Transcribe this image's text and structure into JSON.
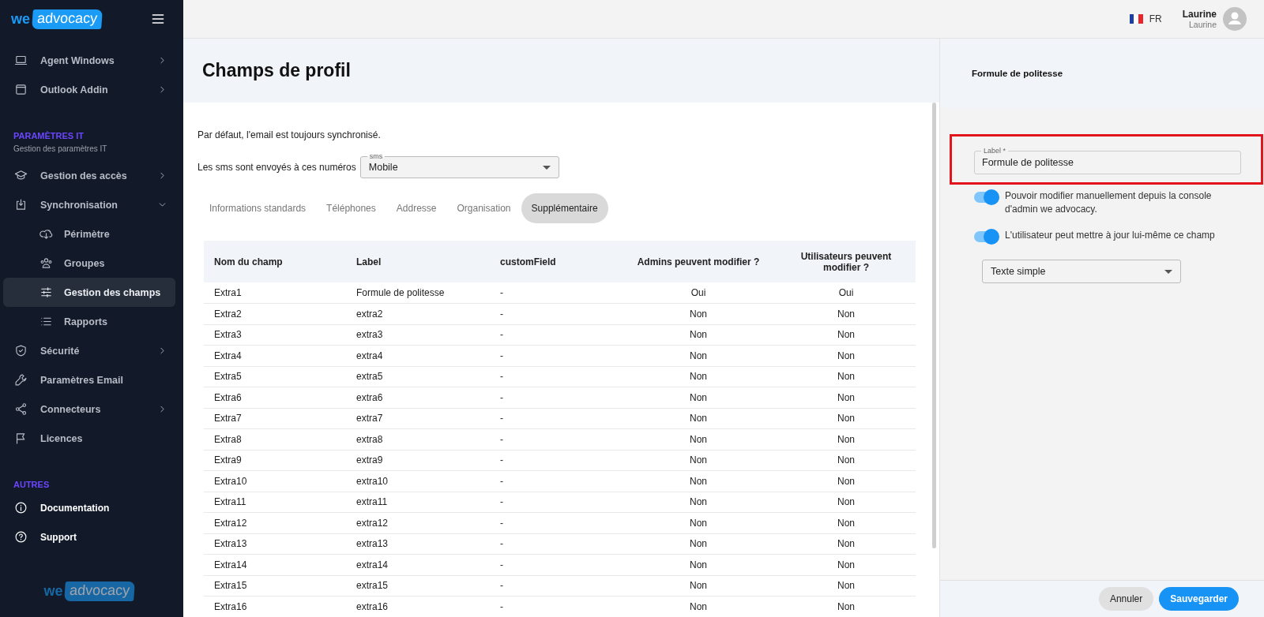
{
  "sidebar": {
    "logo": {
      "part_1": "we",
      "part_2": "advocacy"
    },
    "sections": [
      {
        "items": [
          {
            "label": "Agent Windows",
            "kind": "menu",
            "expanded": false,
            "selected": false
          },
          {
            "label": "Outlook Addin",
            "kind": "menu",
            "expanded": false,
            "selected": false
          }
        ]
      },
      {
        "title": "PARAMÈTRES IT",
        "subtitle": "Gestion des paramètres IT",
        "items": [
          {
            "label": "Gestion des accès",
            "kind": "menu",
            "expanded": false,
            "selected": false
          },
          {
            "label": "Synchronisation",
            "kind": "menu",
            "expanded": true,
            "selected": false,
            "children": [
              {
                "label": "Périmètre",
                "selected": false
              },
              {
                "label": "Groupes",
                "selected": false
              },
              {
                "label": "Gestion des champs",
                "selected": true
              },
              {
                "label": "Rapports",
                "selected": false
              }
            ]
          },
          {
            "label": "Sécurité",
            "kind": "menu",
            "expanded": false,
            "selected": false
          },
          {
            "label": "Paramètres Email",
            "kind": "menu",
            "selected": false
          },
          {
            "label": "Connecteurs",
            "kind": "menu",
            "expanded": false,
            "selected": false
          },
          {
            "label": "Licences",
            "kind": "menu",
            "selected": false
          }
        ]
      },
      {
        "title": "AUTRES",
        "items": [
          {
            "label": "Documentation",
            "kind": "help",
            "selected": false
          },
          {
            "label": "Support",
            "kind": "help",
            "selected": false
          }
        ]
      }
    ],
    "footer_logo": {
      "part_1": "we",
      "part_2": "advocacy"
    }
  },
  "header": {
    "language": "FR",
    "user_name": "Laurine",
    "user_subtitle": "Laurine"
  },
  "page": {
    "title": "Champs de profil",
    "note": "Par défaut, l'email est toujours synchronisé.",
    "sms": {
      "label": "Les sms sont envoyés à ces numéros",
      "field_label": "sms",
      "value": "Mobile"
    },
    "tabs": [
      {
        "label": "Informations standards",
        "selected": false
      },
      {
        "label": "Téléphones",
        "selected": false
      },
      {
        "label": "Addresse",
        "selected": false
      },
      {
        "label": "Organisation",
        "selected": false
      },
      {
        "label": "Supplémentaire",
        "selected": true
      }
    ],
    "table": {
      "columns": [
        "Nom du champ",
        "Label",
        "customField",
        "Admins peuvent modifier ?",
        "Utilisateurs peuvent modifier ?"
      ],
      "rows": [
        [
          "Extra1",
          "Formule de politesse",
          "-",
          "Oui",
          "Oui"
        ],
        [
          "Extra2",
          "extra2",
          "-",
          "Non",
          "Non"
        ],
        [
          "Extra3",
          "extra3",
          "-",
          "Non",
          "Non"
        ],
        [
          "Extra4",
          "extra4",
          "-",
          "Non",
          "Non"
        ],
        [
          "Extra5",
          "extra5",
          "-",
          "Non",
          "Non"
        ],
        [
          "Extra6",
          "extra6",
          "-",
          "Non",
          "Non"
        ],
        [
          "Extra7",
          "extra7",
          "-",
          "Non",
          "Non"
        ],
        [
          "Extra8",
          "extra8",
          "-",
          "Non",
          "Non"
        ],
        [
          "Extra9",
          "extra9",
          "-",
          "Non",
          "Non"
        ],
        [
          "Extra10",
          "extra10",
          "-",
          "Non",
          "Non"
        ],
        [
          "Extra11",
          "extra11",
          "-",
          "Non",
          "Non"
        ],
        [
          "Extra12",
          "extra12",
          "-",
          "Non",
          "Non"
        ],
        [
          "Extra13",
          "extra13",
          "-",
          "Non",
          "Non"
        ],
        [
          "Extra14",
          "extra14",
          "-",
          "Non",
          "Non"
        ],
        [
          "Extra15",
          "extra15",
          "-",
          "Non",
          "Non"
        ],
        [
          "Extra16",
          "extra16",
          "-",
          "Non",
          "Non"
        ]
      ]
    }
  },
  "panel": {
    "title": "Formule de politesse",
    "label_field": {
      "label": "Label *",
      "value": "Formule de politesse",
      "highlighted": true
    },
    "toggles": [
      {
        "label": "Pouvoir modifier manuellement depuis la console d'admin we advocacy.",
        "on": true
      },
      {
        "label": "L'utilisateur peut mettre à jour lui-même ce champ",
        "on": true
      }
    ],
    "type_select": {
      "value": "Texte simple"
    },
    "buttons": [
      {
        "label": "Annuler",
        "kind": "secondary"
      },
      {
        "label": "Sauvegarder",
        "kind": "primary"
      }
    ]
  }
}
